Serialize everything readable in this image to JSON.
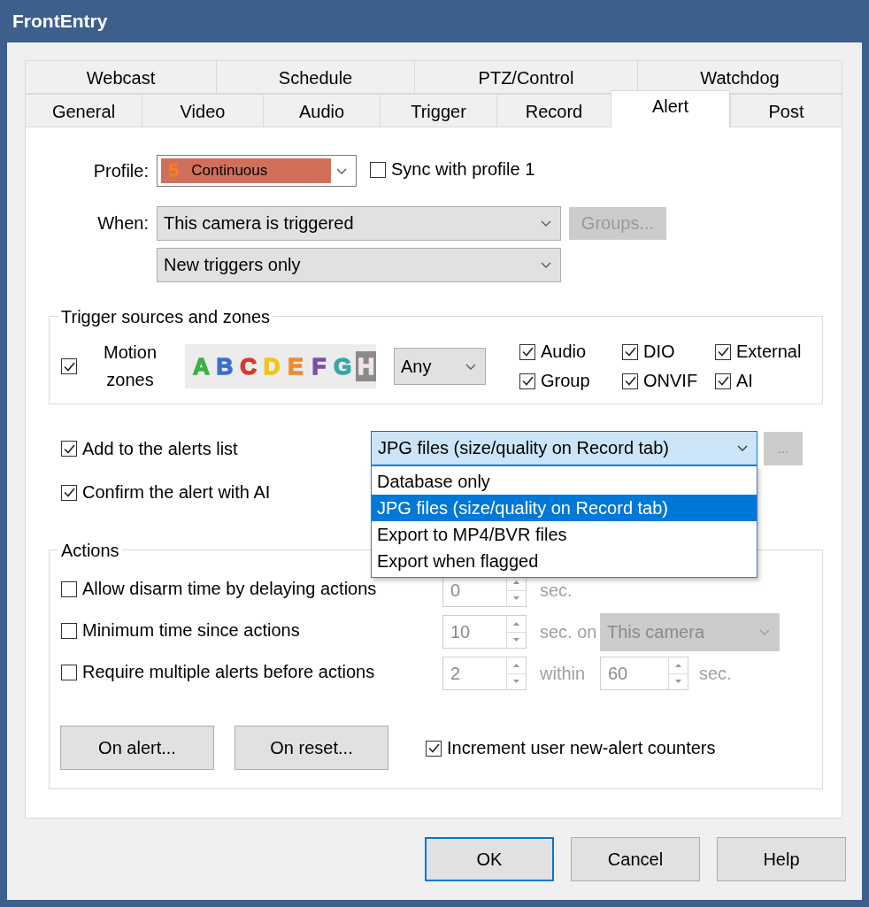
{
  "window": {
    "title": "FrontEntry"
  },
  "tab_rows": [
    {
      "tabs": [
        {
          "label": "Webcast",
          "selected": false
        },
        {
          "label": "Schedule",
          "selected": false
        },
        {
          "label": "PTZ/Control",
          "selected": false
        },
        {
          "label": "Watchdog",
          "selected": false
        }
      ]
    },
    {
      "tabs": [
        {
          "label": "General",
          "selected": false
        },
        {
          "label": "Video",
          "selected": false
        },
        {
          "label": "Audio",
          "selected": false
        },
        {
          "label": "Trigger",
          "selected": false
        },
        {
          "label": "Record",
          "selected": false
        },
        {
          "label": "Alert",
          "selected": true
        },
        {
          "label": "Post",
          "selected": false
        }
      ]
    }
  ],
  "profile": {
    "label": "Profile:",
    "number": "5",
    "value": "Continuous"
  },
  "sync": {
    "label": "Sync with profile 1",
    "checked": false
  },
  "when": {
    "label": "When:",
    "value": "This camera is triggered",
    "mode": "New triggers only",
    "groups_button": {
      "label": "Groups...",
      "disabled": true
    }
  },
  "trigger_sources": {
    "title": "Trigger sources and zones",
    "motion": {
      "label": "Motion zones",
      "checked": true
    },
    "zones": [
      {
        "letter": "A",
        "color": "#3cb043",
        "enabled": true
      },
      {
        "letter": "B",
        "color": "#3a6fc9",
        "enabled": true
      },
      {
        "letter": "C",
        "color": "#d93a2b",
        "enabled": true
      },
      {
        "letter": "D",
        "color": "#f0c419",
        "enabled": true
      },
      {
        "letter": "E",
        "color": "#f08a2c",
        "enabled": true
      },
      {
        "letter": "F",
        "color": "#7b4fa6",
        "enabled": true
      },
      {
        "letter": "G",
        "color": "#3aa6a6",
        "enabled": true
      },
      {
        "letter": "H",
        "color": "#f2e2ee",
        "enabled": false
      }
    ],
    "zone_mode": "Any",
    "sources": [
      {
        "label": "Audio",
        "checked": true
      },
      {
        "label": "DIO",
        "checked": true
      },
      {
        "label": "External",
        "checked": true
      },
      {
        "label": "Group",
        "checked": true
      },
      {
        "label": "ONVIF",
        "checked": true
      },
      {
        "label": "AI",
        "checked": true
      }
    ]
  },
  "alerts_list": {
    "label": "Add to the alerts list",
    "checked": true,
    "format": "JPG files (size/quality on Record tab)",
    "more_button": {
      "label": "...",
      "disabled": true
    },
    "options": [
      {
        "label": "Database only",
        "selected": false
      },
      {
        "label": "JPG files (size/quality on Record tab)",
        "selected": true
      },
      {
        "label": "Export to MP4/BVR files",
        "selected": false
      },
      {
        "label": "Export when flagged",
        "selected": false
      }
    ]
  },
  "confirm_ai": {
    "label": "Confirm the alert with AI",
    "checked": true
  },
  "actions": {
    "title": "Actions",
    "rows": [
      {
        "kind": "simple",
        "label": "Allow disarm time by delaying actions",
        "checked": false,
        "value": "0",
        "unit": "sec."
      },
      {
        "kind": "target",
        "label": "Minimum time since actions",
        "checked": false,
        "value": "10",
        "unit": "sec. on",
        "target": "This camera"
      },
      {
        "kind": "count",
        "label": "Require multiple alerts before actions",
        "checked": false,
        "value": "2",
        "unit": "within",
        "value2": "60",
        "unit2": "sec."
      }
    ],
    "buttons": [
      {
        "label": "On alert..."
      },
      {
        "label": "On reset..."
      }
    ],
    "increment": {
      "label": "Increment user new-alert counters",
      "checked": true
    }
  },
  "buttons": [
    {
      "label": "OK",
      "default": true
    },
    {
      "label": "Cancel",
      "default": false
    },
    {
      "label": "Help",
      "default": false
    }
  ]
}
